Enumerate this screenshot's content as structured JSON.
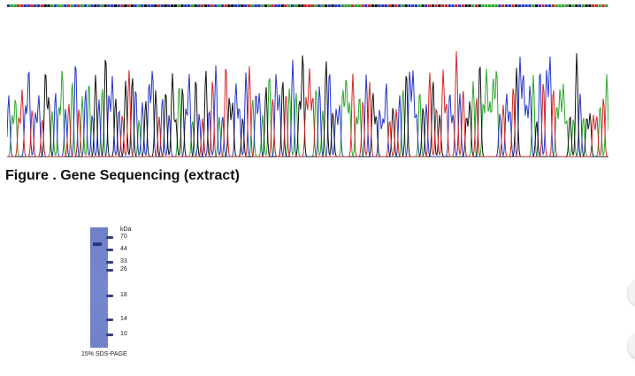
{
  "sequence": {
    "bases": "CAATTCCTCCTGGACAACTACTACACGCAGCCGCTGTGCACGCCGTCGCGGAGCCAGCTGCTCACTGGCCGCTACCAGATCCGTACAGGTTTACAGCGCCAAATAATCTGGCCCTGTCAGCCCAGCTGTGTTCCTCTGGATGAAAAACTCCTGCCCCAGCTCCTAAAAGAGCAGGTTATA",
    "channel_colors": {
      "A": "#29a829",
      "C": "#2436c8",
      "G": "#111111",
      "T": "#d22525"
    }
  },
  "figure": {
    "caption": "Figure . Gene Sequencing (extract)"
  },
  "gel": {
    "unit_label": "kDa",
    "markers": [
      {
        "label": "70",
        "kda": 70
      },
      {
        "label": "44",
        "kda": 44
      },
      {
        "label": "33",
        "kda": 33
      },
      {
        "label": "26",
        "kda": 26
      },
      {
        "label": "18",
        "kda": 18
      },
      {
        "label": "14",
        "kda": 14
      },
      {
        "label": "10",
        "kda": 10
      }
    ],
    "caption": "15% SDS-PAGE"
  }
}
